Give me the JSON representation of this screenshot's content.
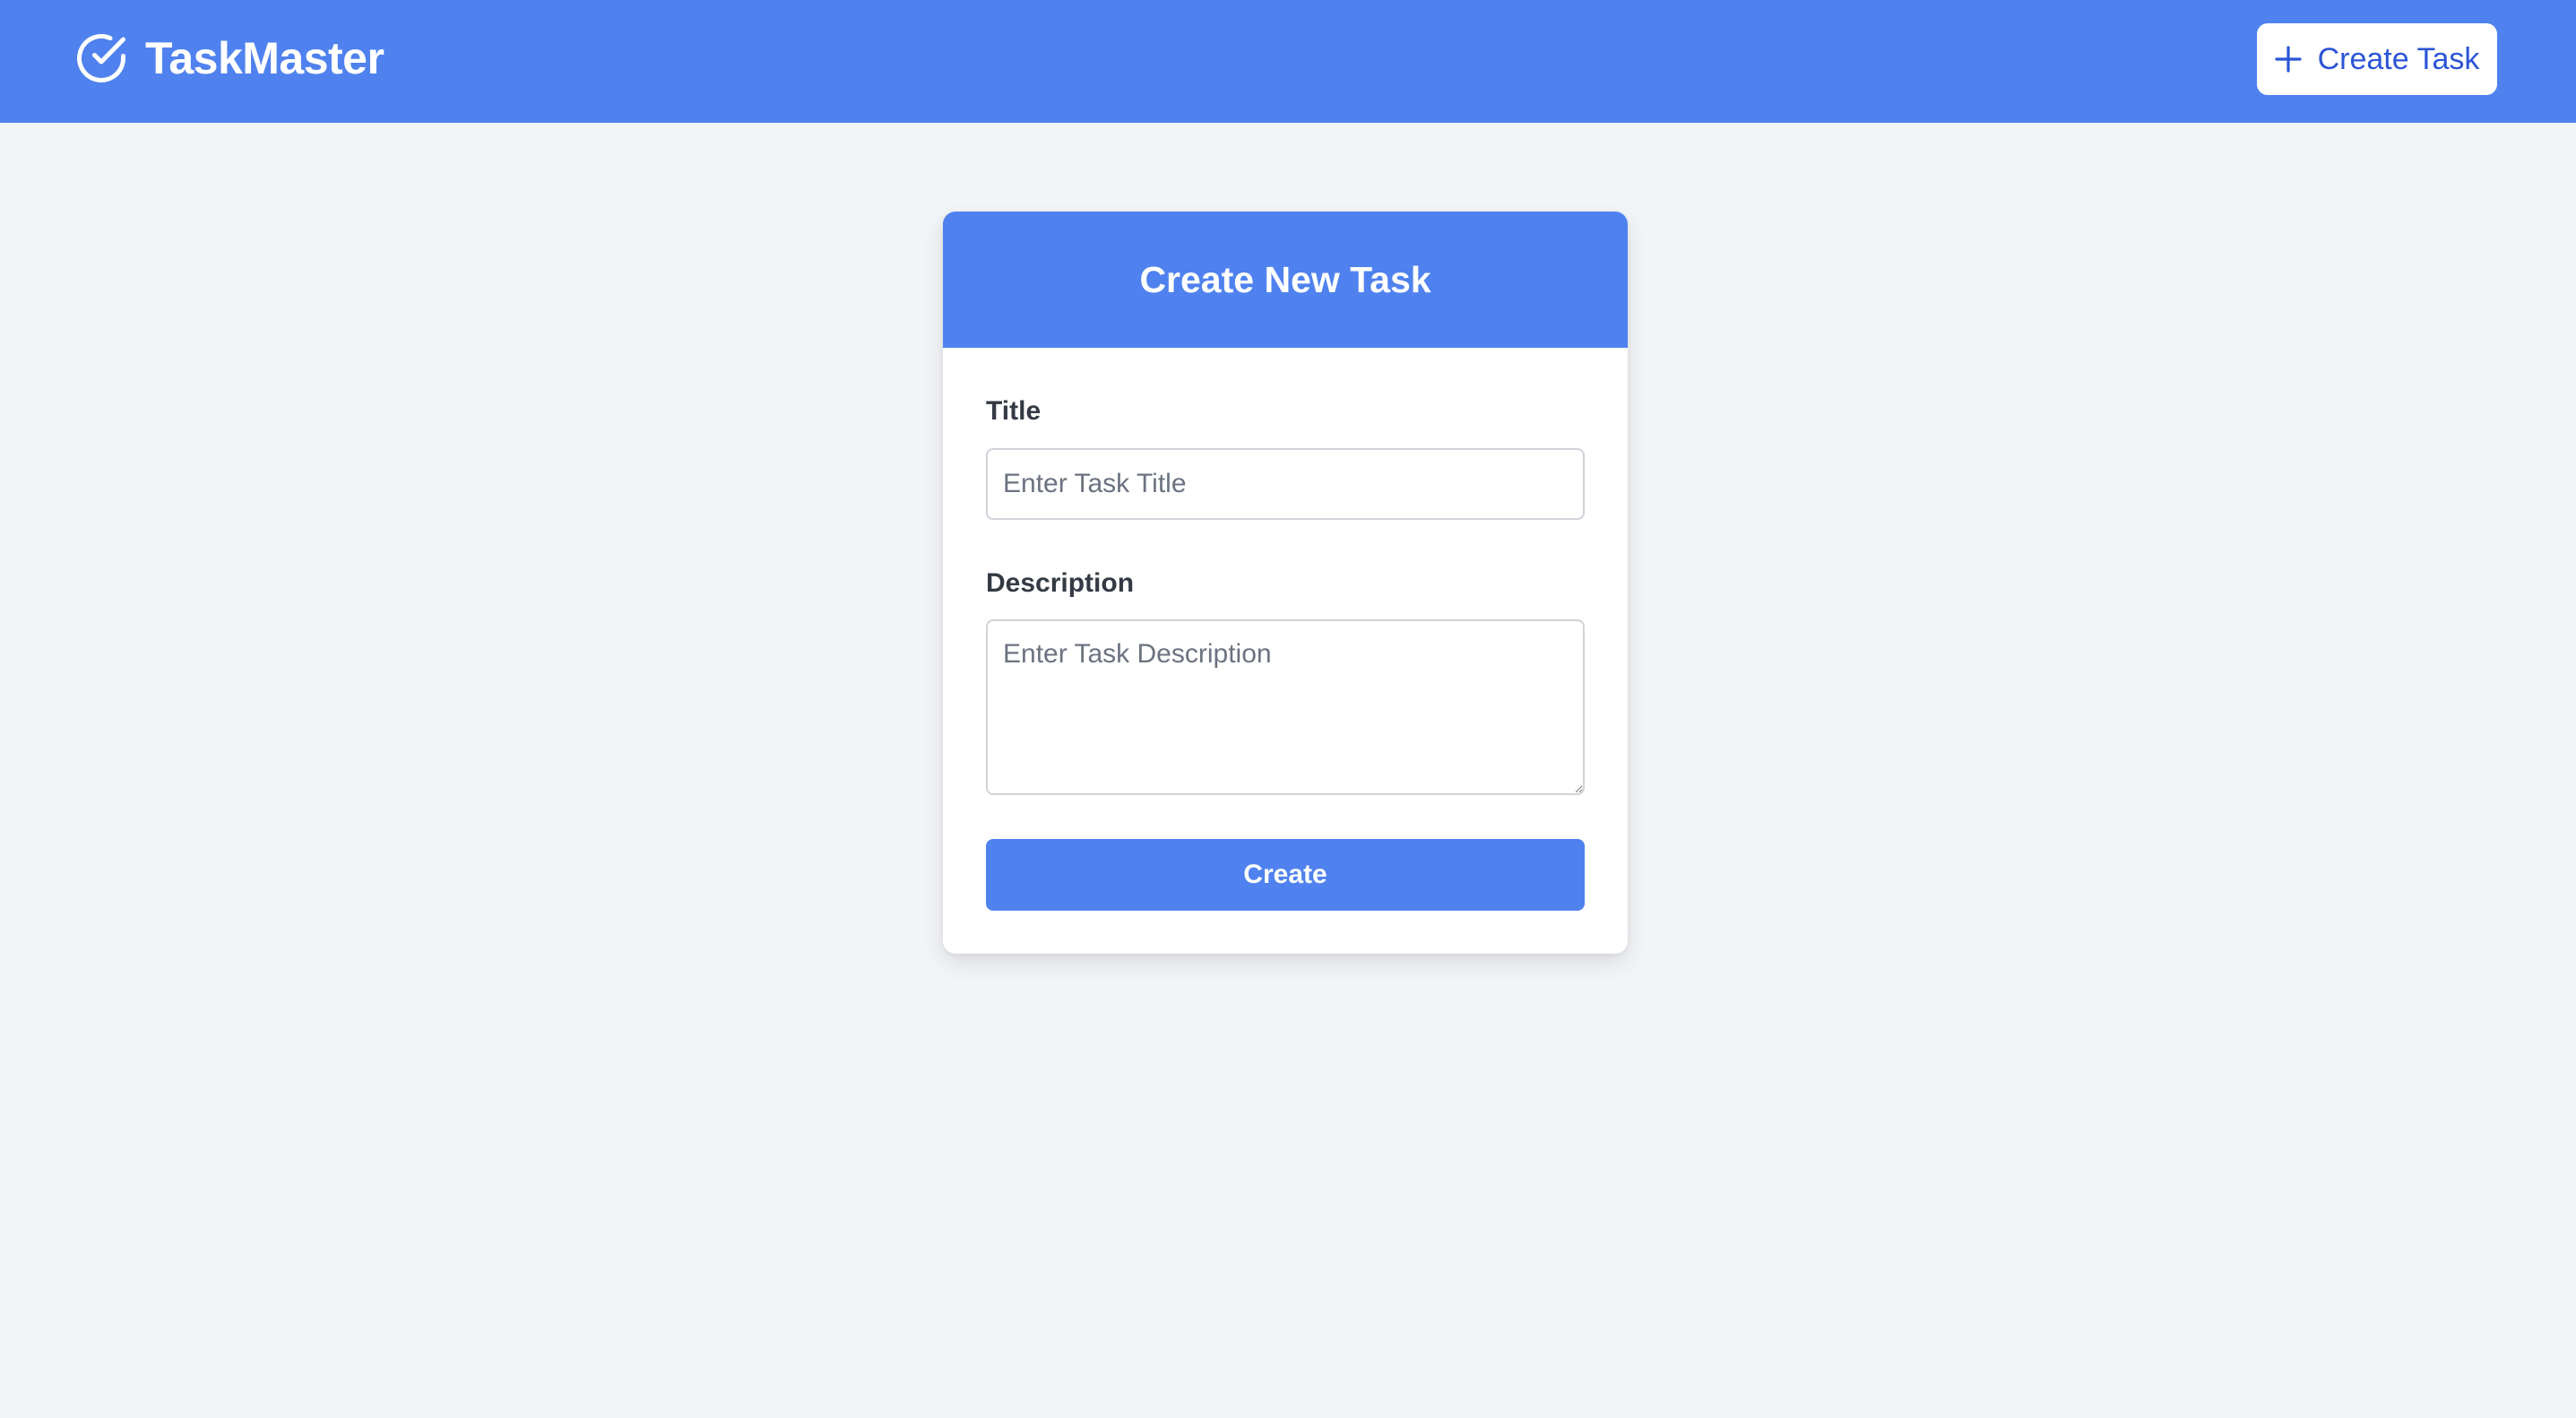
{
  "navbar": {
    "brand_name": "TaskMaster",
    "brand_icon": "check-circle-icon",
    "create_task_label": "Create Task",
    "create_task_icon": "plus-icon",
    "background_color": "#4f82ee"
  },
  "form": {
    "title": "Create New Task",
    "title_label": "Title",
    "title_placeholder": "Enter Task Title",
    "title_value": "",
    "description_label": "Description",
    "description_placeholder": "Enter Task Description",
    "description_value": "",
    "submit_label": "Create",
    "accent_color": "#4f82ee"
  }
}
